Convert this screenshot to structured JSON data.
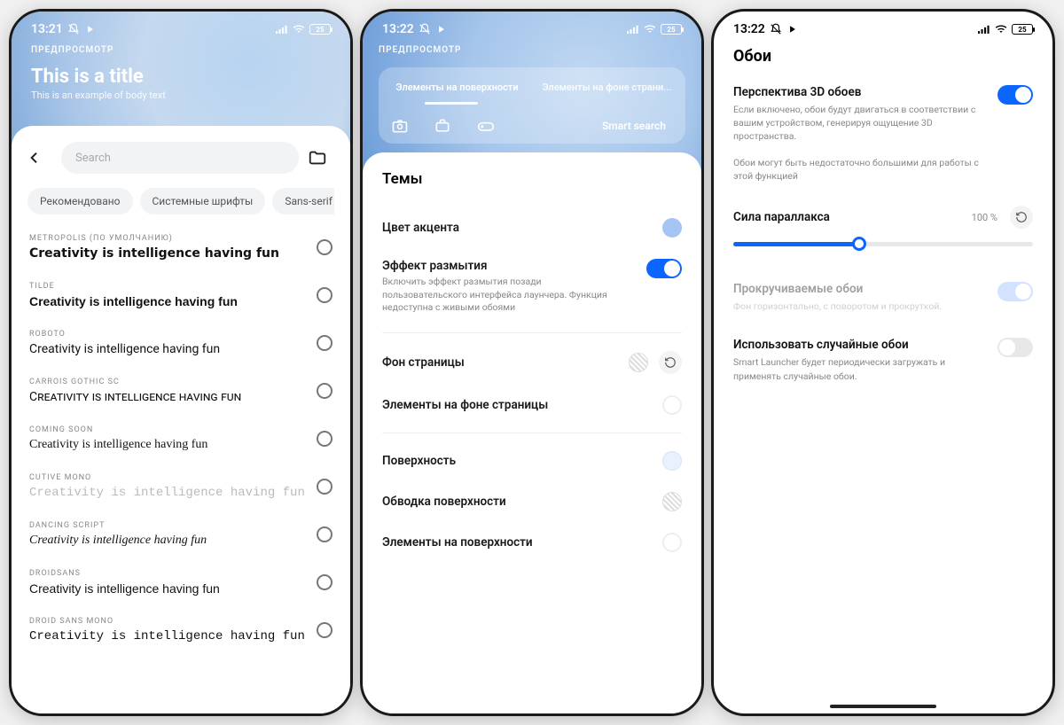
{
  "status": {
    "time1": "13:21",
    "time2": "13:22",
    "time3": "13:22",
    "battery": "25"
  },
  "phone1": {
    "preview": "ПРЕДПРОСМОТР",
    "title": "This is a title",
    "body": "This is an example of body text",
    "search_placeholder": "Search",
    "chips": [
      "Рекомендовано",
      "Системные шрифты",
      "Sans-serif"
    ],
    "fonts": [
      {
        "name": "METROPOLIS (ПО УМОЛЧАНИЮ)",
        "sample": "Creativity is intelligence having fun",
        "weight": "700",
        "family": "system-ui"
      },
      {
        "name": "TILDE",
        "sample": "Creativity is intelligence having fun",
        "weight": "600",
        "family": "Arial"
      },
      {
        "name": "ROBOTO",
        "sample": "Creativity is intelligence having fun",
        "weight": "400",
        "family": "Roboto, Arial"
      },
      {
        "name": "CARROIS GOTHIC SC",
        "sample": "Creativity is intelligence having fun",
        "weight": "400",
        "family": "small-caps normal 400 14px Arial",
        "variant": "small-caps"
      },
      {
        "name": "COMING SOON",
        "sample": "Creativity is intelligence having fun",
        "weight": "400",
        "family": "'Comic Sans MS', cursive"
      },
      {
        "name": "CUTIVE MONO",
        "sample": "Creativity is intelligence having fun",
        "weight": "400",
        "family": "'Courier New', monospace",
        "color": "#bbb"
      },
      {
        "name": "DANCING SCRIPT",
        "sample": "Creativity is intelligence having fun",
        "weight": "400",
        "family": "'Brush Script MT', cursive",
        "style": "italic"
      },
      {
        "name": "DROIDSANS",
        "sample": "Creativity is intelligence having fun",
        "weight": "400",
        "family": "Arial"
      },
      {
        "name": "DROID SANS MONO",
        "sample": "Creativity is intelligence having fun",
        "weight": "400",
        "family": "'Courier New', monospace"
      }
    ]
  },
  "phone2": {
    "preview": "ПРЕДПРОСМОТР",
    "tab1": "Элементы на поверхности",
    "tab2": "Элементы на фоне страни...",
    "smart": "Smart search",
    "heading": "Темы",
    "accent": "Цвет акцента",
    "blur": "Эффект размытия",
    "blur_desc": "Включить эффект размытия позади пользовательского интерфейса лаунчера. Функция недоступна с живыми обоями",
    "pagefg": "Фон страницы",
    "pageels": "Элементы на фоне страницы",
    "surface": "Поверхность",
    "surface_stroke": "Обводка поверхности",
    "surface_els": "Элементы на поверхности"
  },
  "phone3": {
    "title": "Обои",
    "persp": "Перспектива 3D обоев",
    "persp_desc": "Если включено, обои будут двигаться в соответствии с вашим устройством, генерируя ощущение 3D пространства.",
    "persp_note": "Обои могут быть недостаточно большими для работы с этой функцией",
    "parallax": "Сила параллакса",
    "parallax_val": "100 %",
    "scroll": "Прокручиваемые обои",
    "scroll_desc": "Фон горизонтально, с поворотом и прокруткой.",
    "random": "Использовать случайные обои",
    "random_desc": "Smart Launcher будет периодически загружать и применять случайные обои."
  }
}
